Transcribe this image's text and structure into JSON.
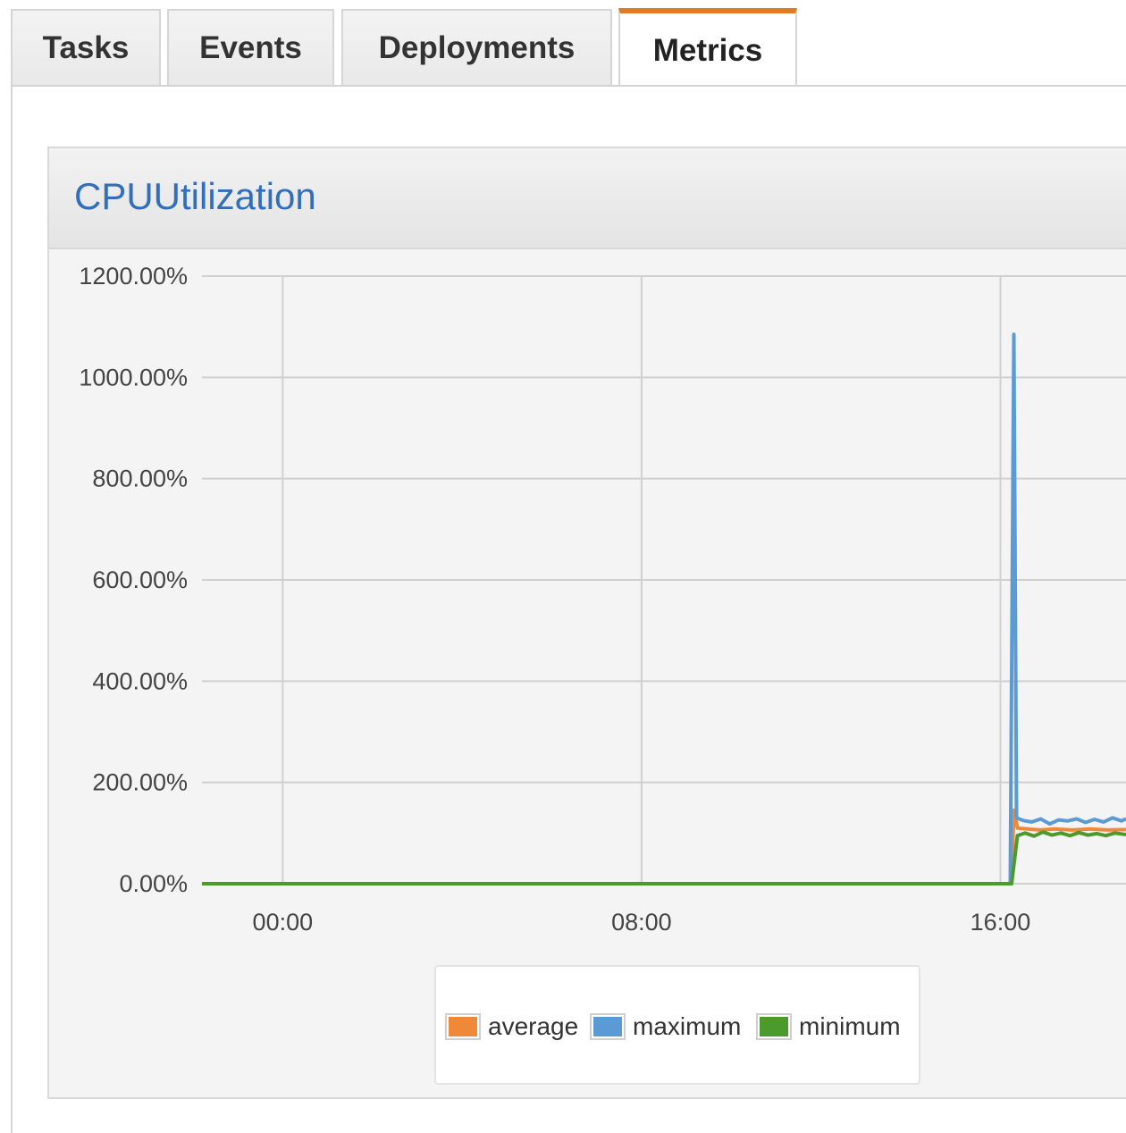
{
  "tabs": [
    {
      "label": "Tasks",
      "active": false
    },
    {
      "label": "Events",
      "active": false
    },
    {
      "label": "Deployments",
      "active": false
    },
    {
      "label": "Metrics",
      "active": true
    }
  ],
  "colors": {
    "active_tab_accent": "#e07b24",
    "title_link": "#2f6fbd",
    "average": "#f0883a",
    "maximum": "#5b9bd5",
    "minimum": "#4a9a2c"
  },
  "panel": {
    "title": "CPUUtilization"
  },
  "legend": {
    "items": [
      {
        "label": "average",
        "color_key": "average"
      },
      {
        "label": "maximum",
        "color_key": "maximum"
      },
      {
        "label": "minimum",
        "color_key": "minimum"
      }
    ]
  },
  "chart_data": {
    "type": "line",
    "title": "CPUUtilization",
    "xlabel": "",
    "ylabel": "",
    "y_ticks": [
      "0.00%",
      "200.00%",
      "400.00%",
      "600.00%",
      "800.00%",
      "1000.00%",
      "1200.00%"
    ],
    "x_ticks": [
      "00:00",
      "08:00",
      "16:00"
    ],
    "ylim": [
      0,
      1200
    ],
    "x_unit": "hours",
    "xlim": [
      -1.8,
      18.8
    ],
    "x_tick_values": [
      0,
      8,
      16
    ],
    "grid": true,
    "legend_position": "bottom-center",
    "series": [
      {
        "name": "average",
        "color_key": "average",
        "points": [
          [
            -1.8,
            0
          ],
          [
            16.25,
            0
          ],
          [
            16.3,
            145
          ],
          [
            16.38,
            110
          ],
          [
            16.6,
            108
          ],
          [
            16.9,
            106
          ],
          [
            17.2,
            108
          ],
          [
            17.6,
            106
          ],
          [
            18.0,
            108
          ],
          [
            18.4,
            106
          ],
          [
            18.8,
            107
          ]
        ]
      },
      {
        "name": "maximum",
        "color_key": "maximum",
        "points": [
          [
            -1.8,
            0
          ],
          [
            16.22,
            0
          ],
          [
            16.3,
            1085
          ],
          [
            16.36,
            130
          ],
          [
            16.5,
            125
          ],
          [
            16.7,
            122
          ],
          [
            16.9,
            128
          ],
          [
            17.1,
            118
          ],
          [
            17.3,
            126
          ],
          [
            17.5,
            124
          ],
          [
            17.7,
            128
          ],
          [
            17.9,
            121
          ],
          [
            18.1,
            127
          ],
          [
            18.3,
            122
          ],
          [
            18.5,
            130
          ],
          [
            18.7,
            124
          ],
          [
            18.8,
            128
          ]
        ]
      },
      {
        "name": "minimum",
        "color_key": "minimum",
        "points": [
          [
            -1.8,
            0
          ],
          [
            16.25,
            0
          ],
          [
            16.38,
            95
          ],
          [
            16.55,
            100
          ],
          [
            16.75,
            94
          ],
          [
            16.95,
            102
          ],
          [
            17.15,
            96
          ],
          [
            17.35,
            100
          ],
          [
            17.55,
            95
          ],
          [
            17.75,
            101
          ],
          [
            17.95,
            96
          ],
          [
            18.15,
            99
          ],
          [
            18.35,
            95
          ],
          [
            18.55,
            100
          ],
          [
            18.8,
            97
          ]
        ]
      }
    ]
  }
}
